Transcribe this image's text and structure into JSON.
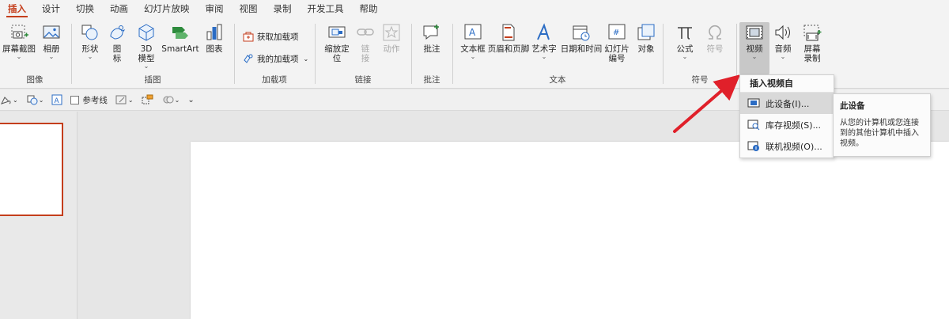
{
  "tabs": [
    "插入",
    "设计",
    "切换",
    "动画",
    "幻灯片放映",
    "审阅",
    "视图",
    "录制",
    "开发工具",
    "帮助"
  ],
  "ribbon": {
    "images": {
      "label": "图像",
      "screenshot": "屏幕截图",
      "album": "相册"
    },
    "illustrations": {
      "label": "插图",
      "shapes": "形状",
      "icons": "图\n标",
      "model3d": "3D\n模型",
      "smartart": "SmartArt",
      "chart": "图表"
    },
    "addins": {
      "label": "加载项",
      "get": "获取加载项",
      "mine": "我的加载项"
    },
    "links": {
      "label": "链接",
      "zoom": "缩放定\n位",
      "link": "链\n接",
      "action": "动作"
    },
    "comments": {
      "label": "批注",
      "comment": "批注"
    },
    "text": {
      "label": "文本",
      "textbox": "文本框",
      "header": "页眉和页脚",
      "wordart": "艺术字",
      "datetime": "日期和时间",
      "slidenum": "幻灯片\n编号",
      "object": "对象"
    },
    "symbols": {
      "label": "符号",
      "equation": "公式",
      "symbol": "符号"
    },
    "media": {
      "video": "视频",
      "audio": "音频",
      "screenrec": "屏幕\n录制"
    }
  },
  "qat": {
    "guides": "参考线"
  },
  "dropdown": {
    "header": "插入视频自",
    "items": [
      {
        "label": "此设备(I)..."
      },
      {
        "label": "库存视频(S)..."
      },
      {
        "label": "联机视频(O)..."
      }
    ]
  },
  "tooltip": {
    "title": "此设备",
    "body": "从您的计算机或您连接到的其他计算机中插入视频。"
  },
  "colors": {
    "accent": "#c43e1c",
    "arrow": "#e0202a",
    "blue": "#2b6cc4"
  }
}
